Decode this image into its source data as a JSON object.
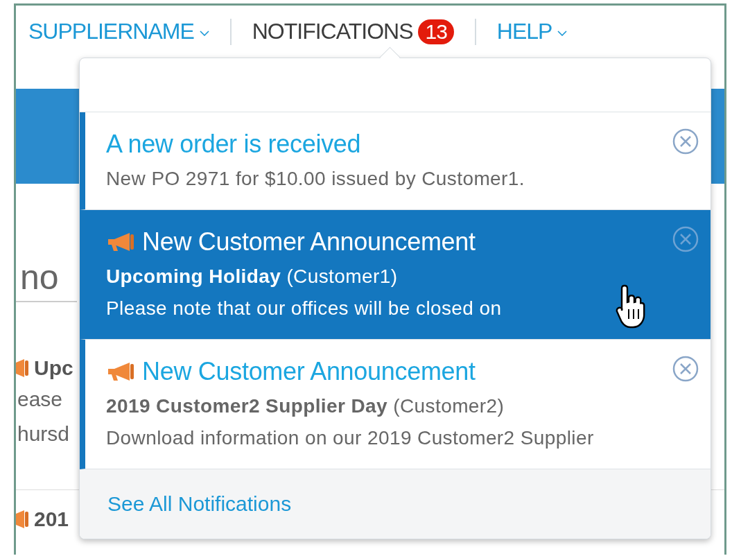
{
  "nav": [
    {
      "label": "SUPPLIERNAME",
      "kind": "menu"
    },
    {
      "label": "NOTIFICATIONS",
      "kind": "notifications",
      "badge": "13"
    },
    {
      "label": "HELP",
      "kind": "menu"
    }
  ],
  "background": {
    "heading": "no",
    "entries": [
      {
        "title": "Upc",
        "lines": [
          "ease",
          "hursd"
        ]
      },
      {
        "title": "201"
      }
    ]
  },
  "notifications": {
    "items": [
      {
        "kind": "order",
        "title": "A new order is received",
        "body": "New PO 2971 for $10.00 issued by Customer1.",
        "selected": false
      },
      {
        "kind": "announcement",
        "title": "New Customer Announcement",
        "subject": "Upcoming Holiday",
        "customer": "(Customer1)",
        "body": "Please note that our offices will be closed on",
        "selected": true
      },
      {
        "kind": "announcement",
        "title": "New Customer Announcement",
        "subject": "2019 Customer2 Supplier Day",
        "customer": "(Customer2)",
        "body": "Download information on our 2019 Customer2 Supplier",
        "selected": false
      }
    ],
    "footer_link": "See All Notifications"
  }
}
